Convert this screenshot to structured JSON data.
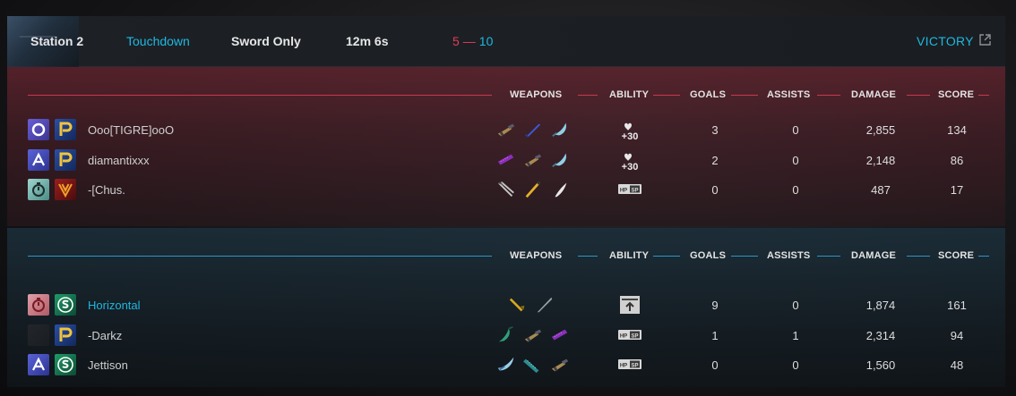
{
  "header": {
    "map": "Station 2",
    "mode": "Touchdown",
    "rule": "Sword Only",
    "duration": "12m 6s",
    "score_red": "5",
    "score_sep": "—",
    "score_blue": "10",
    "result": "VICTORY",
    "external_icon": "external-link-icon"
  },
  "columns": {
    "weapons": "WEAPONS",
    "ability": "ABILITY",
    "goals": "GOALS",
    "assists": "ASSISTS",
    "damage": "DAMAGE",
    "score": "SCORE"
  },
  "colors": {
    "red_team": "#c8384f",
    "blue_team": "#2a97c7",
    "accent": "#1fb7e0"
  },
  "red_team": {
    "players": [
      {
        "name": "Ooo[TIGRE]ooO",
        "emblems": [
          "ring-emblem-icon",
          "gold-p-emblem-icon"
        ],
        "weapons": [
          "gun-weapon-icon",
          "blue-sword-weapon-icon",
          "axe-weapon-icon"
        ],
        "ability": "heal-plus-30-icon",
        "ability_text": "+30",
        "goals": "3",
        "assists": "0",
        "damage": "2,855",
        "score": "134"
      },
      {
        "name": "diamantixxx",
        "emblems": [
          "blue-a-emblem-icon",
          "gold-p-emblem-icon"
        ],
        "weapons": [
          "purple-blaster-weapon-icon",
          "gun-weapon-icon",
          "axe-weapon-icon"
        ],
        "ability": "heal-plus-30-icon",
        "ability_text": "+30",
        "goals": "2",
        "assists": "0",
        "damage": "2,148",
        "score": "86"
      },
      {
        "name": "-[Chus.",
        "emblems": [
          "stopwatch-emblem-icon",
          "red-v-emblem-icon"
        ],
        "weapons": [
          "scissor-blade-weapon-icon",
          "gold-staff-weapon-icon",
          "white-blade-weapon-icon"
        ],
        "ability": "hp-sp-icon",
        "ability_text": "HP SP",
        "goals": "0",
        "assists": "0",
        "damage": "487",
        "score": "17"
      }
    ]
  },
  "blue_team": {
    "players": [
      {
        "name": "Horizontal",
        "emblems": [
          "red-stopwatch-emblem-icon",
          "green-s-emblem-icon"
        ],
        "weapons": [
          "gold-sword-weapon-icon",
          "grey-blade-weapon-icon"
        ],
        "ability": "upload-box-icon",
        "ability_text": "",
        "goals": "9",
        "assists": "0",
        "damage": "1,874",
        "score": "161"
      },
      {
        "name": "-Darkz",
        "emblems": [
          "empty-emblem-icon",
          "gold-p-emblem-icon"
        ],
        "weapons": [
          "green-blade-weapon-icon",
          "gun-weapon-icon",
          "purple-blaster-weapon-icon"
        ],
        "ability": "hp-sp-icon",
        "ability_text": "HP SP",
        "goals": "1",
        "assists": "1",
        "damage": "2,314",
        "score": "94"
      },
      {
        "name": "Jettison",
        "emblems": [
          "blue-a-emblem-icon",
          "green-s-emblem-icon"
        ],
        "weapons": [
          "blue-wing-weapon-icon",
          "teal-blaster-weapon-icon",
          "gun-weapon-icon"
        ],
        "ability": "hp-sp-icon",
        "ability_text": "HP SP",
        "goals": "0",
        "assists": "0",
        "damage": "1,560",
        "score": "48"
      }
    ]
  }
}
